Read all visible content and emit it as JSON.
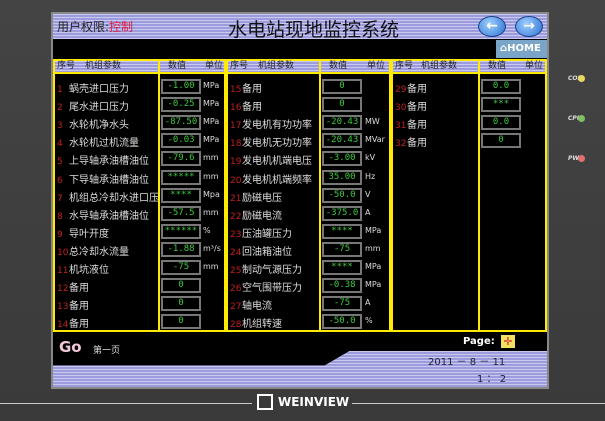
{
  "header": {
    "permission_label": "用户权限:",
    "permission_value": "控制",
    "title": "水电站现地监控系统",
    "back_icon": "arrow-left-icon",
    "forward_icon": "arrow-right-icon",
    "home_label": "HOME"
  },
  "columns": {
    "seq": "序号",
    "param": "机组参数",
    "value": "数值",
    "unit": "单位"
  },
  "panels": [
    {
      "rows": [
        {
          "n": "1",
          "name": "蜗壳进口压力",
          "value": "-1.00",
          "unit": "MPa"
        },
        {
          "n": "2",
          "name": "尾水进口压力",
          "value": "-0.25",
          "unit": "MPa"
        },
        {
          "n": "3",
          "name": "水轮机净水头",
          "value": "-87.50",
          "unit": "MPa"
        },
        {
          "n": "4",
          "name": "水轮机过机流量",
          "value": "-0.03",
          "unit": "MPa"
        },
        {
          "n": "5",
          "name": "上导轴承油槽油位",
          "value": "-79.6",
          "unit": "mm"
        },
        {
          "n": "6",
          "name": "下导轴承油槽油位",
          "value": "*****",
          "unit": "mm"
        },
        {
          "n": "7",
          "name": "机组总冷却水进口压",
          "value": "****",
          "unit": "Mpa"
        },
        {
          "n": "8",
          "name": "水导轴承油槽油位",
          "value": "-57.5",
          "unit": "mm"
        },
        {
          "n": "9",
          "name": "导叶开度",
          "value": "******",
          "unit": "%"
        },
        {
          "n": "10",
          "name": "总冷却水流量",
          "value": "-1.88",
          "unit": "m³/s"
        },
        {
          "n": "11",
          "name": "机坑液位",
          "value": "-75",
          "unit": "mm"
        },
        {
          "n": "12",
          "name": "备用",
          "value": "0",
          "unit": ""
        },
        {
          "n": "13",
          "name": "备用",
          "value": "0",
          "unit": ""
        },
        {
          "n": "14",
          "name": "备用",
          "value": "0",
          "unit": ""
        }
      ]
    },
    {
      "rows": [
        {
          "n": "15",
          "name": "备用",
          "value": "0",
          "unit": ""
        },
        {
          "n": "16",
          "name": "备用",
          "value": "0",
          "unit": ""
        },
        {
          "n": "17",
          "name": "发电机有功功率",
          "value": "-20.43",
          "unit": "MW"
        },
        {
          "n": "18",
          "name": "发电机无功功率",
          "value": "-20.43",
          "unit": "MVar"
        },
        {
          "n": "19",
          "name": "发电机机端电压",
          "value": "-3.00",
          "unit": "kV"
        },
        {
          "n": "20",
          "name": "发电机机端频率",
          "value": "35.00",
          "unit": "Hz"
        },
        {
          "n": "21",
          "name": "励磁电压",
          "value": "-50.0",
          "unit": "V"
        },
        {
          "n": "22",
          "name": "励磁电流",
          "value": "-375.0",
          "unit": "A"
        },
        {
          "n": "23",
          "name": "压油罐压力",
          "value": "****",
          "unit": "MPa"
        },
        {
          "n": "24",
          "name": "回油箱油位",
          "value": "-75",
          "unit": "mm"
        },
        {
          "n": "25",
          "name": "制动气源压力",
          "value": "****",
          "unit": "MPa"
        },
        {
          "n": "26",
          "name": "空气围带压力",
          "value": "-0.38",
          "unit": "MPa"
        },
        {
          "n": "27",
          "name": "轴电流",
          "value": "-75",
          "unit": "A"
        },
        {
          "n": "28",
          "name": "机组转速",
          "value": "-50.0",
          "unit": "%"
        }
      ]
    },
    {
      "rows": [
        {
          "n": "29",
          "name": "备用",
          "value": "0.0",
          "unit": ""
        },
        {
          "n": "30",
          "name": "备用",
          "value": "***",
          "unit": ""
        },
        {
          "n": "31",
          "name": "备用",
          "value": "0.0",
          "unit": ""
        },
        {
          "n": "32",
          "name": "备用",
          "value": "0",
          "unit": ""
        }
      ]
    }
  ],
  "footer": {
    "go": "Go",
    "first_page": "第一页",
    "page_label": "Page:",
    "page_icon": "page-select-icon",
    "date": "2011 － 8 － 11",
    "time": "1 ： 2"
  },
  "leds": [
    {
      "label": "COM",
      "color": "#e8d860"
    },
    {
      "label": "CPU",
      "color": "#80c060"
    },
    {
      "label": "PWR",
      "color": "#e07070"
    }
  ],
  "brand": "WEINVIEW"
}
